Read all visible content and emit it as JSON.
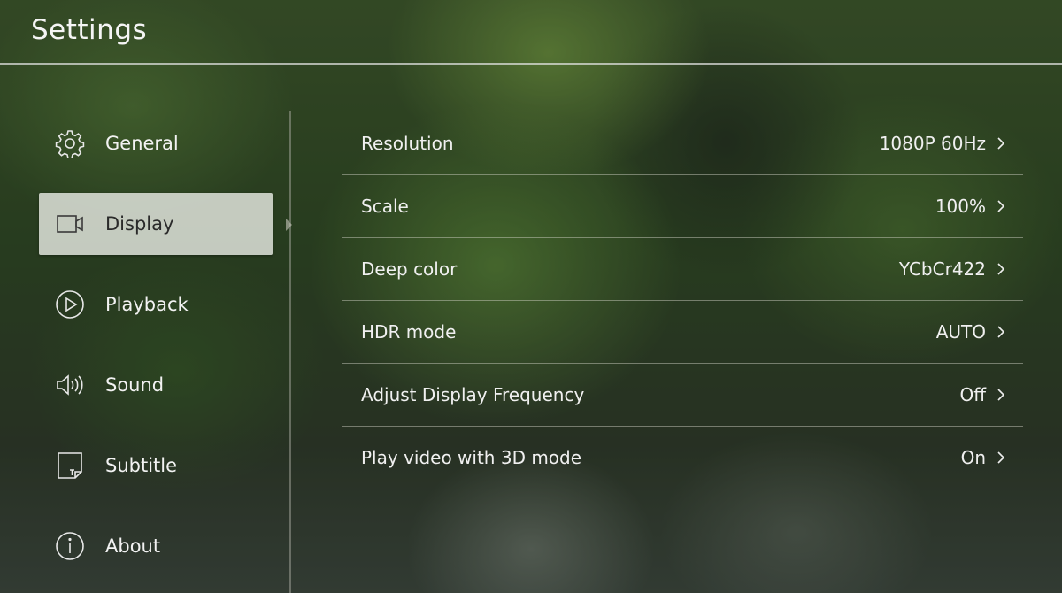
{
  "header": {
    "title": "Settings"
  },
  "sidebar": {
    "items": [
      {
        "label": "General",
        "icon": "gear-icon"
      },
      {
        "label": "Display",
        "icon": "display-camera-icon",
        "selected": true
      },
      {
        "label": "Playback",
        "icon": "play-circle-icon"
      },
      {
        "label": "Sound",
        "icon": "speaker-icon"
      },
      {
        "label": "Subtitle",
        "icon": "subtitle-icon"
      },
      {
        "label": "About",
        "icon": "info-icon"
      }
    ]
  },
  "display_settings": {
    "rows": [
      {
        "label": "Resolution",
        "value": "1080P 60Hz"
      },
      {
        "label": "Scale",
        "value": "100%"
      },
      {
        "label": "Deep color",
        "value": "YCbCr422"
      },
      {
        "label": "HDR mode",
        "value": "AUTO"
      },
      {
        "label": "Adjust Display Frequency",
        "value": "Off"
      },
      {
        "label": "Play video with 3D mode",
        "value": "On"
      }
    ]
  },
  "colors": {
    "selected_background": "#e1e4dc",
    "selected_text": "#2a2a2a",
    "text": "#f2f2f2"
  }
}
